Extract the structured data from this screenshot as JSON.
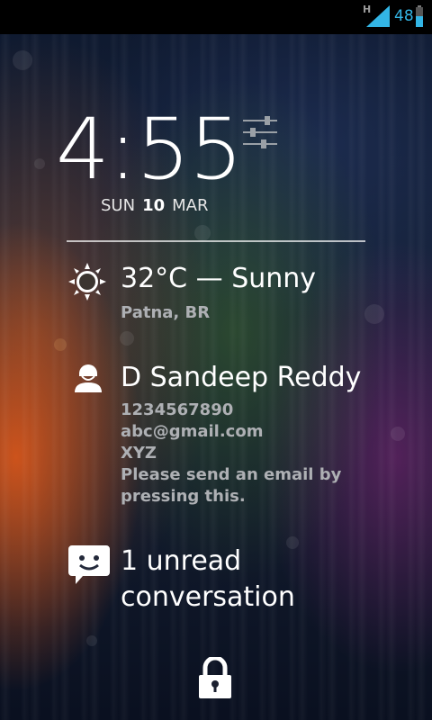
{
  "status_bar": {
    "network_type": "H",
    "battery_level": "48",
    "accent_color": "#33b5e5"
  },
  "clock": {
    "time": "4:55",
    "date": {
      "weekday": "SUN",
      "day": "10",
      "month": "MAR"
    }
  },
  "weather": {
    "icon": "sun-icon",
    "summary": "32°C — Sunny",
    "location": "Patna, BR"
  },
  "contact": {
    "icon": "person-icon",
    "name": "D Sandeep Reddy",
    "phone": "1234567890",
    "email": "abc@gmail.com",
    "company": "XYZ",
    "note_line1": "Please send an email by",
    "note_line2": "pressing this."
  },
  "messages": {
    "icon": "chat-bubble-icon",
    "line1": "1 unread",
    "line2": "conversation"
  },
  "lock": {
    "icon": "padlock-icon"
  }
}
